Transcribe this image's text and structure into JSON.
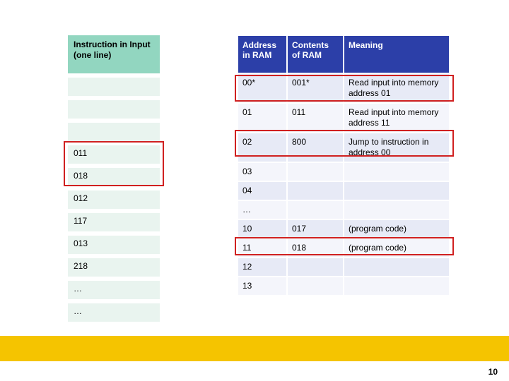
{
  "left": {
    "header": "Instruction in Input (one line)",
    "rows": [
      "",
      "",
      "",
      "011",
      "018",
      "012",
      "117",
      "013",
      "218",
      "…",
      "…"
    ]
  },
  "right": {
    "headers": {
      "addr": "Address in RAM",
      "cont": "Contents of RAM",
      "mean": "Meaning"
    },
    "rows": [
      {
        "addr": "00*",
        "cont": "001*",
        "mean": "Read input into memory address 01"
      },
      {
        "addr": "01",
        "cont": "011",
        "mean": "Read input into memory address 11"
      },
      {
        "addr": "02",
        "cont": "800",
        "mean": "Jump to instruction in address 00"
      },
      {
        "addr": "03",
        "cont": "",
        "mean": ""
      },
      {
        "addr": "04",
        "cont": "",
        "mean": ""
      },
      {
        "addr": "…",
        "cont": "",
        "mean": ""
      },
      {
        "addr": "10",
        "cont": "017",
        "mean": "(program code)"
      },
      {
        "addr": "11",
        "cont": "018",
        "mean": "(program code)"
      },
      {
        "addr": "12",
        "cont": "",
        "mean": ""
      },
      {
        "addr": "13",
        "cont": "",
        "mean": ""
      }
    ]
  },
  "page_number": "10"
}
